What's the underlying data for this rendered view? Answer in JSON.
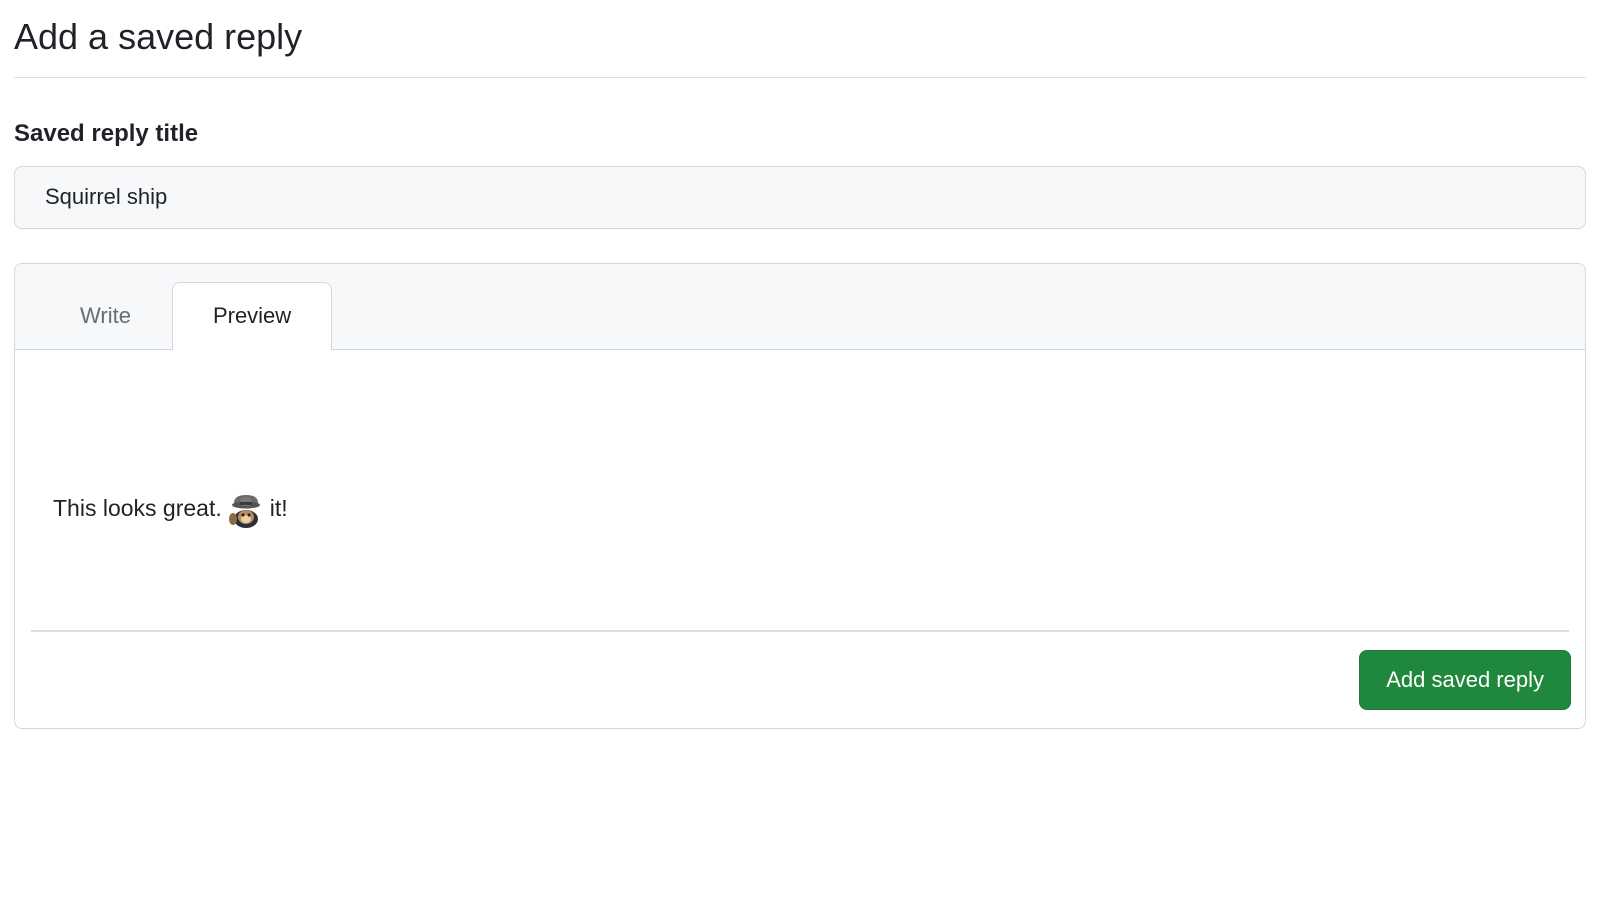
{
  "page": {
    "title": "Add a saved reply"
  },
  "form": {
    "title_label": "Saved reply title",
    "title_value": "Squirrel ship"
  },
  "editor": {
    "tabs": {
      "write": "Write",
      "preview": "Preview",
      "active": "preview"
    },
    "preview": {
      "text_before": "This looks great.",
      "emoji_name": "shipit-squirrel",
      "text_after": "it!"
    }
  },
  "actions": {
    "submit_label": "Add saved reply"
  }
}
